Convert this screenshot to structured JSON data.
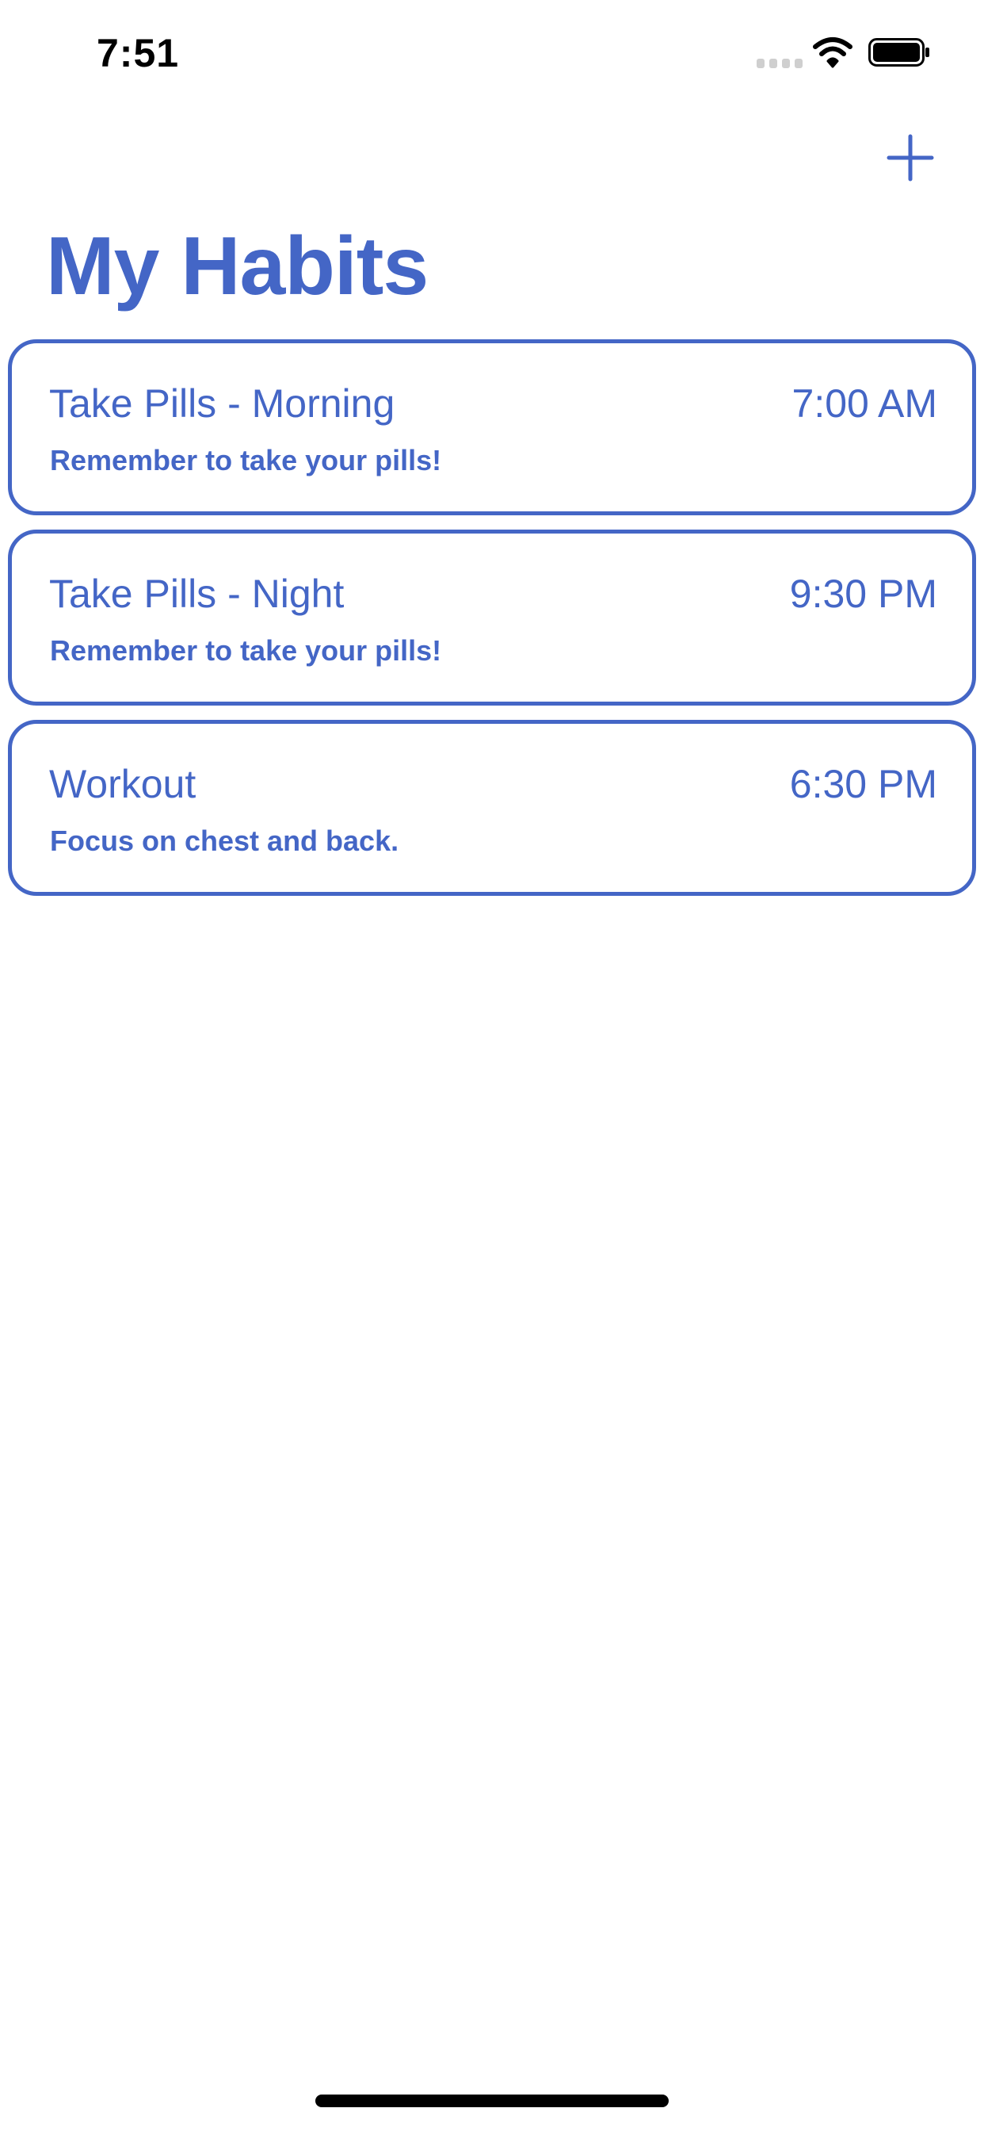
{
  "status_bar": {
    "time": "7:51",
    "icons": [
      "signal-dots-icon",
      "wifi-icon",
      "battery-icon"
    ]
  },
  "nav": {
    "add_icon": "plus-icon"
  },
  "page": {
    "title": "My Habits"
  },
  "habits": [
    {
      "name": "Take Pills - Morning",
      "time": "7:00 AM",
      "note": "Remember to take your pills!"
    },
    {
      "name": "Take Pills - Night",
      "time": "9:30 PM",
      "note": "Remember to take your pills!"
    },
    {
      "name": "Workout",
      "time": "6:30 PM",
      "note": "Focus on chest and back."
    }
  ],
  "colors": {
    "accent": "#4466c6",
    "background": "#ffffff",
    "text_dark": "#000000"
  }
}
